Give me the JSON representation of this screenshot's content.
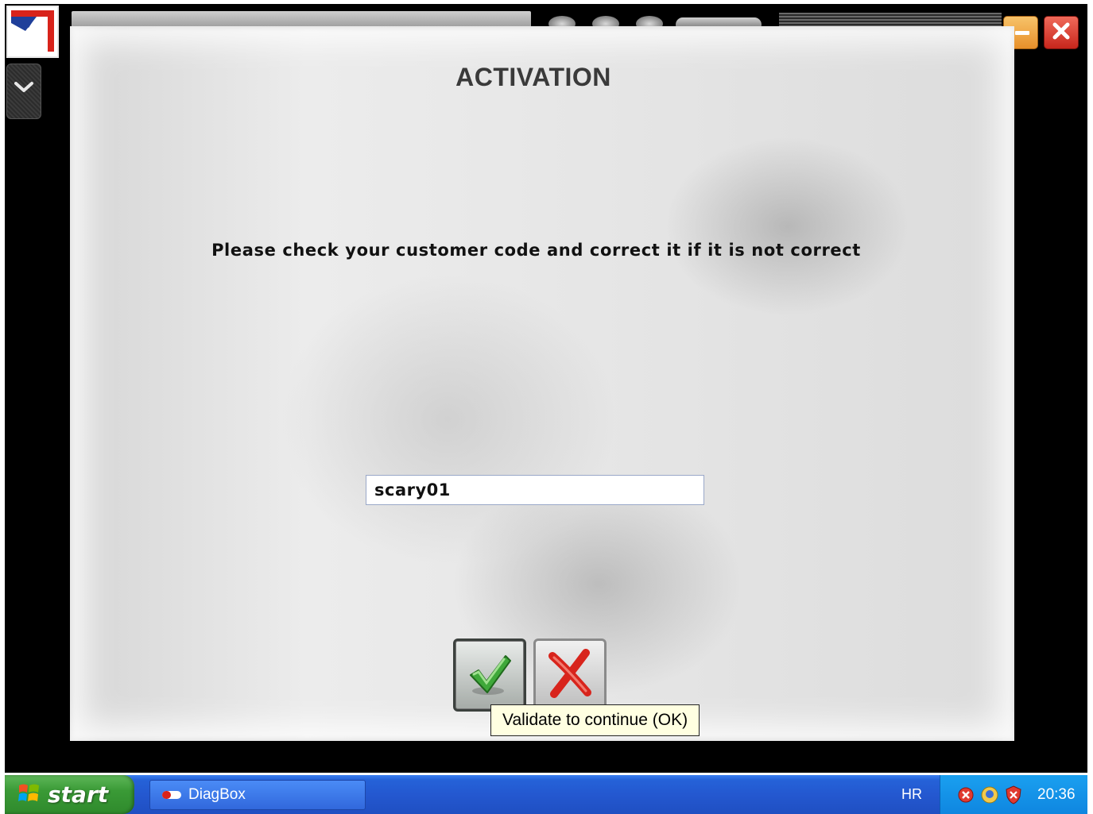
{
  "dialog": {
    "title": "ACTIVATION",
    "instruction": "Please check your customer code and correct it if it is not correct",
    "customer_code": "scary01",
    "tooltip": "Validate to continue (OK)"
  },
  "taskbar": {
    "start_label": "start",
    "tasks": [
      {
        "label": "DiagBox"
      }
    ],
    "language": "HR",
    "clock": "20:36"
  },
  "icons": {
    "logo": "app-logo",
    "chevron": "chevron-down-icon",
    "minimize": "minimize-icon",
    "close": "close-icon",
    "ok": "check-icon",
    "cancel": "cross-icon",
    "windows": "windows-flag-icon",
    "tray": [
      "security-alert-icon",
      "network-icon",
      "shield-icon"
    ]
  },
  "colors": {
    "ok_check": "#3fa83a",
    "cancel_cross": "#d8241c",
    "minimize": "#f0a040",
    "close": "#d8362a",
    "taskbar": "#2458d0",
    "start": "#3a9a36",
    "tooltip_bg": "#ffffe1"
  }
}
